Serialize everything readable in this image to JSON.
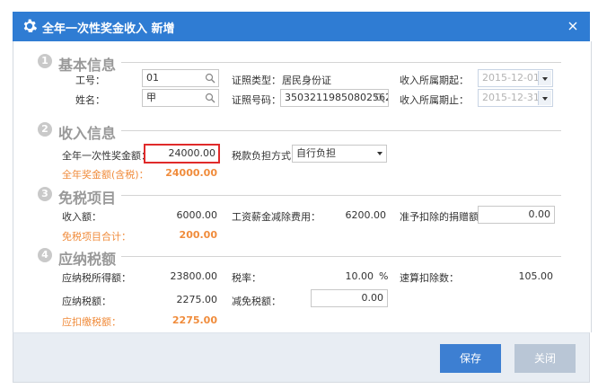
{
  "window": {
    "title": "全年一次性奖金收入 新增",
    "icon": "gear-icon",
    "close_icon": "close-icon"
  },
  "basic": {
    "number": "1",
    "title": "基本信息",
    "emp_no_label": "工号：",
    "emp_no_value": "01",
    "name_label": "姓名：",
    "name_value": "甲",
    "id_type_label": "证照类型：",
    "id_type_value": "居民身份证",
    "id_no_label": "证照号码：",
    "id_no_value": "35032119850802562",
    "period_start_label": "收入所属期起：",
    "period_start_value": "2015-12-01",
    "period_end_label": "收入所属期止：",
    "period_end_value": "2015-12-31"
  },
  "income": {
    "number": "2",
    "title": "收入信息",
    "bonus_label": "全年一次性奖金额：",
    "bonus_value": "24000.00",
    "tax_method_label": "税款负担方式：",
    "tax_method_value": "自行负担",
    "bonus_total_label": "全年奖金额(含税)：",
    "bonus_total_value": "24000.00"
  },
  "exempt": {
    "number": "3",
    "title": "免税项目",
    "income_label": "收入额：",
    "income_value": "6000.00",
    "salary_deduct_label": "工资薪金减除费用：",
    "salary_deduct_value": "6200.00",
    "donation_label": "准予扣除的捐赠额：",
    "donation_value": "0.00",
    "exempt_total_label": "免税项目合计：",
    "exempt_total_value": "200.00"
  },
  "tax": {
    "number": "4",
    "title": "应纳税额",
    "taxable_income_label": "应纳税所得额：",
    "taxable_income_value": "23800.00",
    "rate_label": "税率：",
    "rate_value": "10.00",
    "rate_unit": "%",
    "quick_deduct_label": "速算扣除数：",
    "quick_deduct_value": "105.00",
    "tax_payable_label": "应纳税额：",
    "tax_payable_value": "2275.00",
    "relief_label": "减免税额：",
    "relief_value": "0.00",
    "withhold_label": "应扣缴税额：",
    "withhold_value": "2275.00"
  },
  "footer": {
    "save_label": "保存",
    "close_label": "关闭"
  },
  "colors": {
    "title_bar": "#2f7cd3",
    "save_button": "#3d7fd2",
    "close_button": "#b9c6d6",
    "highlight": "#e02a2a",
    "total_text": "#f08c3c"
  }
}
